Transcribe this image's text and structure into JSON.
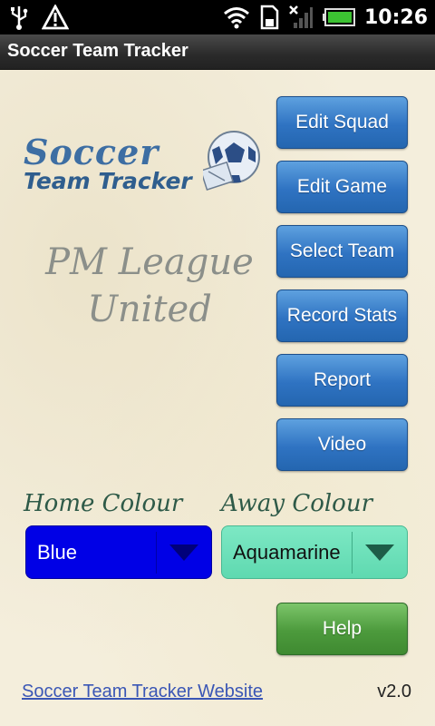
{
  "status_bar": {
    "time": "10:26",
    "icons": [
      "usb-icon",
      "warning-icon",
      "wifi-icon",
      "sd-card-icon",
      "signal-off-icon",
      "battery-icon"
    ]
  },
  "app": {
    "title": "Soccer Team Tracker"
  },
  "logo": {
    "line1": "Soccer",
    "line2": "Team Tracker"
  },
  "team": {
    "name_line1": "PM League",
    "name_line2": "United"
  },
  "menu": {
    "edit_squad": "Edit Squad",
    "edit_game": "Edit Game",
    "select_team": "Select Team",
    "record_stats": "Record Stats",
    "report": "Report",
    "video": "Video",
    "help": "Help"
  },
  "colours": {
    "home_label": "Home Colour",
    "away_label": "Away Colour",
    "home_value": "Blue",
    "away_value": "Aquamarine",
    "home_hex": "#0000e6",
    "away_hex": "#66e0b6"
  },
  "footer": {
    "website_link": "Soccer Team Tracker Website",
    "version": "v2.0"
  }
}
